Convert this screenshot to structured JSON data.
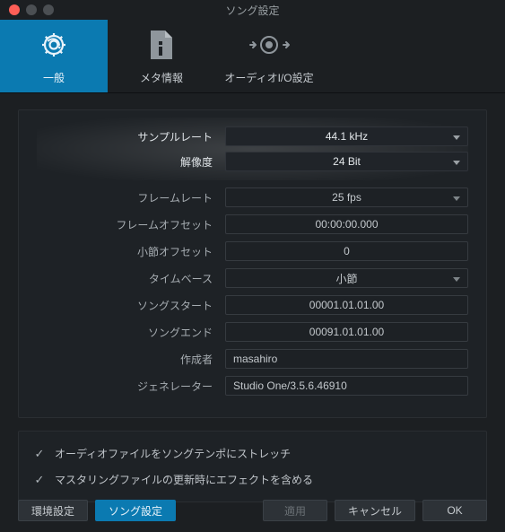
{
  "window": {
    "title": "ソング設定"
  },
  "tabs": {
    "general": "一般",
    "meta": "メタ情報",
    "audioio": "オーディオI/O設定"
  },
  "fields": {
    "sample_rate": {
      "label": "サンプルレート",
      "value": "44.1 kHz"
    },
    "resolution": {
      "label": "解像度",
      "value": "24 Bit"
    },
    "frame_rate": {
      "label": "フレームレート",
      "value": "25 fps"
    },
    "frame_offset": {
      "label": "フレームオフセット",
      "value": "00:00:00.000"
    },
    "bar_offset": {
      "label": "小節オフセット",
      "value": "0"
    },
    "timebase": {
      "label": "タイムベース",
      "value": "小節"
    },
    "song_start": {
      "label": "ソングスタート",
      "value": "00001.01.01.00"
    },
    "song_end": {
      "label": "ソングエンド",
      "value": "00091.01.01.00"
    },
    "author": {
      "label": "作成者",
      "value": "masahiro"
    },
    "generator": {
      "label": "ジェネレーター",
      "value": "Studio One/3.5.6.46910"
    }
  },
  "checks": {
    "stretch": "オーディオファイルをソングテンポにストレッチ",
    "master_fx": "マスタリングファイルの更新時にエフェクトを含める"
  },
  "footer": {
    "env": "環境設定",
    "song": "ソング設定",
    "apply": "適用",
    "cancel": "キャンセル",
    "ok": "OK"
  }
}
